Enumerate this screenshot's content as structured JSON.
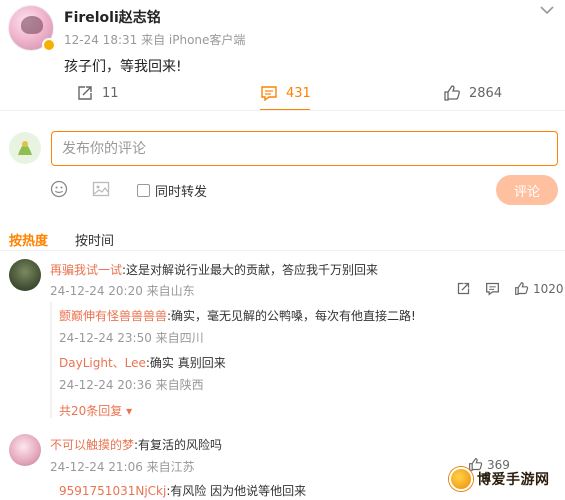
{
  "post": {
    "author": "Fireloli赵志铭",
    "meta": "12-24 18:31 来自 iPhone客户端",
    "text": "孩子们，等我回来!",
    "reposts": "11",
    "comments": "431",
    "likes": "2864"
  },
  "compose": {
    "placeholder": "发布你的评论",
    "repost_label": "同时转发",
    "submit_label": "评论"
  },
  "sort": {
    "hot": "按热度",
    "time": "按时间"
  },
  "comments": [
    {
      "user": "再骗我试一试",
      "text": ":这是对解说行业最大的贡献，答应我千万别回来",
      "meta": "24-12-24 20:20 来自山东",
      "likes": "1020",
      "replies": [
        {
          "user": "颤巅伸有怪兽兽兽兽",
          "text": ":确实，毫无见解的公鸭嗓，每次有他直接二路!",
          "meta": "24-12-24 23:50 来自四川"
        },
        {
          "user": "DayLight、Lee",
          "text": ":确实 真别回来",
          "meta": "24-12-24 20:36 来自陕西"
        }
      ],
      "more_replies": "共20条回复"
    },
    {
      "user": "不可以触摸的梦",
      "text": ":有复活的风险吗",
      "meta": "24-12-24 21:06 来自江苏",
      "likes": "369",
      "replies": [
        {
          "user": "9591751031NjCkj",
          "text": ":有风险 因为他说等他回来"
        }
      ]
    }
  ],
  "watermark": "博爱手游网",
  "colors": {
    "accent": "#ff8200",
    "username": "#eb7350",
    "submit_disabled": "#ffc09f"
  }
}
